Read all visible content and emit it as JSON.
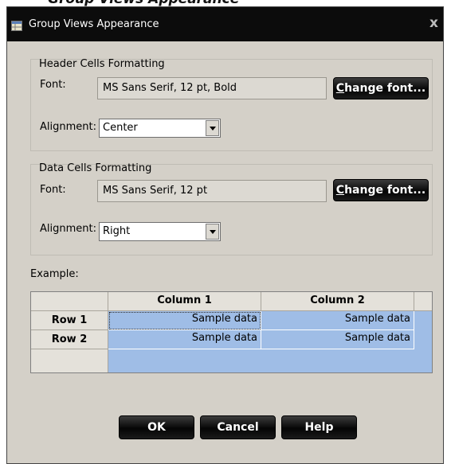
{
  "background_caption": "Group Views Appearance",
  "window": {
    "title": "Group Views Appearance",
    "icon": "table-icon",
    "close_glyph": "x"
  },
  "header_group": {
    "title": "Header Cells Formatting",
    "font_label": "Font:",
    "font_value": "MS Sans Serif, 12 pt, Bold",
    "change_font_accel": "C",
    "change_font_rest": "hange font...",
    "alignment_label": "Alignment:",
    "alignment_value": "Center"
  },
  "data_group": {
    "title": "Data Cells Formatting",
    "font_label": "Font:",
    "font_value": "MS Sans Serif, 12 pt",
    "change_font_accel": "C",
    "change_font_rest": "hange font...",
    "alignment_label": "Alignment:",
    "alignment_value": "Right"
  },
  "example": {
    "label": "Example:",
    "columns": [
      "Column 1",
      "Column 2"
    ],
    "rows": [
      {
        "header": "Row 1",
        "cells": [
          "Sample data",
          "Sample data"
        ]
      },
      {
        "header": "Row 2",
        "cells": [
          "Sample data",
          "Sample data"
        ]
      }
    ]
  },
  "buttons": {
    "ok": "OK",
    "cancel": "Cancel",
    "help": "Help"
  },
  "colors": {
    "titlebar": "#0c0c0c",
    "dialog_bg": "#d4d0c8",
    "selection_blue": "#9fbde6",
    "button_black": "#0a0a0a"
  }
}
